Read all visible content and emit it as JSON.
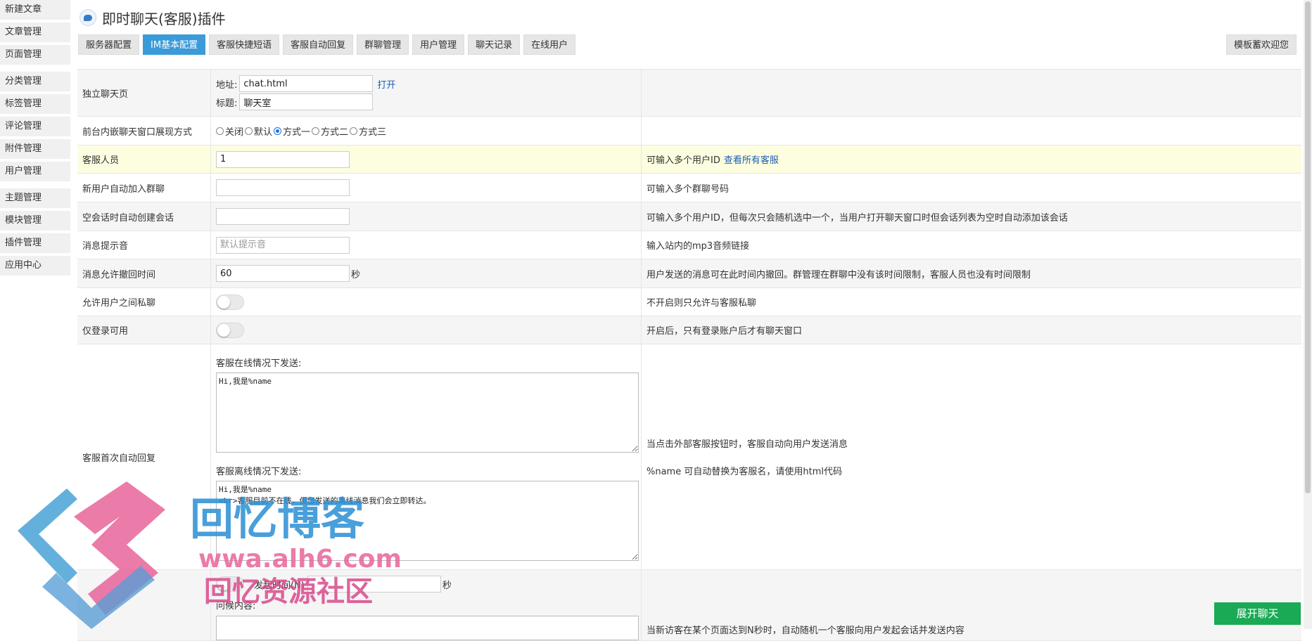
{
  "sidebar": {
    "items": [
      {
        "label": "新建文章"
      },
      {
        "label": "文章管理"
      },
      {
        "label": "页面管理"
      },
      {
        "label": "分类管理"
      },
      {
        "label": "标签管理"
      },
      {
        "label": "评论管理"
      },
      {
        "label": "附件管理"
      },
      {
        "label": "用户管理"
      },
      {
        "label": "主题管理"
      },
      {
        "label": "模块管理"
      },
      {
        "label": "插件管理"
      },
      {
        "label": "应用中心"
      }
    ]
  },
  "header": {
    "title": "即时聊天(客服)插件",
    "icon": "chat-bubble-icon"
  },
  "tabs": [
    {
      "label": "服务器配置",
      "active": false
    },
    {
      "label": "IM基本配置",
      "active": true
    },
    {
      "label": "客服快捷短语",
      "active": false
    },
    {
      "label": "客服自动回复",
      "active": false
    },
    {
      "label": "群聊管理",
      "active": false
    },
    {
      "label": "用户管理",
      "active": false
    },
    {
      "label": "聊天记录",
      "active": false
    },
    {
      "label": "在线用户",
      "active": false
    }
  ],
  "template_button": "模板蓄欢迎您",
  "colors": {
    "accent": "#3a9bd8",
    "highlight_row": "#fdfde0",
    "chat_button": "#1aaa55"
  },
  "form": {
    "standalone": {
      "label": "独立聊天页",
      "addr_label": "地址:",
      "addr_value": "chat.html",
      "open_link": "打开",
      "title_label": "标题:",
      "title_value": "聊天室"
    },
    "embed_mode": {
      "label": "前台内嵌聊天窗口展现方式",
      "options": [
        "关闭",
        "默认",
        "方式一",
        "方式二",
        "方式三"
      ],
      "selected": "方式一"
    },
    "staff": {
      "label": "客服人员",
      "value": "1",
      "hint": "可输入多个用户ID",
      "hint_link": "查看所有客服"
    },
    "auto_group": {
      "label": "新用户自动加入群聊",
      "value": "",
      "hint": "可输入多个群聊号码"
    },
    "auto_session": {
      "label": "空会话时自动创建会话",
      "value": "",
      "hint": "可输入多个用户ID，但每次只会随机选中一个，当用户打开聊天窗口时但会话列表为空时自动添加该会话"
    },
    "sound": {
      "label": "消息提示音",
      "placeholder": "默认提示音",
      "hint": "输入站内的mp3音频链接"
    },
    "recall": {
      "label": "消息允许撤回时间",
      "value": "60",
      "unit": "秒",
      "hint": "用户发送的消息可在此时间内撤回。群管理在群聊中没有该时间限制，客服人员也没有时间限制"
    },
    "private_chat": {
      "label": "允许用户之间私聊",
      "enabled": false,
      "hint": "不开启则只允许与客服私聊"
    },
    "login_only": {
      "label": "仅登录可用",
      "enabled": false,
      "hint": "开启后，只有登录账户后才有聊天窗口"
    },
    "first_reply": {
      "label": "客服首次自动回复",
      "online_label": "客服在线情况下发送:",
      "online_text": "Hi,我是%name",
      "offline_label": "客服离线情况下发送:",
      "offline_text": "Hi,我是%name\n<br>客服目前不在线，但您发送的离线消息我们会立即转达。",
      "hint1": "当点击外部客服按钮时，客服自动向用户发送消息",
      "hint2": "%name 可自动替换为客服名，请使用html代码"
    },
    "visitor_greet": {
      "trigger_label": "发起时间(N)",
      "trigger_unit": "秒",
      "content_label": "问候内容:",
      "hint": "当新访客在某个页面达到N秒时，自动随机一个客服向用户发起会话并发送内容"
    }
  },
  "chat_button": "展开聊天",
  "watermark": {
    "title": "回忆博客",
    "url": "wwa.alh6.com",
    "sub": "回忆资源社区"
  }
}
